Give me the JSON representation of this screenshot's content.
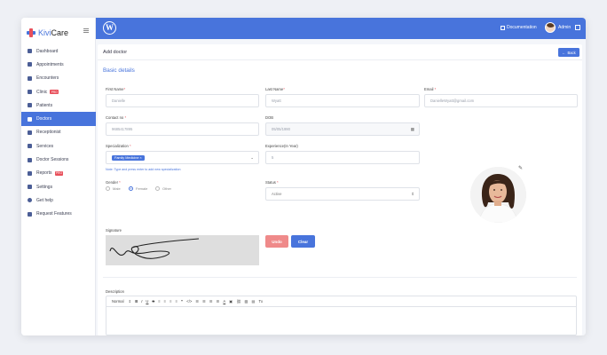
{
  "brand": {
    "name_part1": "Kivi",
    "name_part2": "Care"
  },
  "sidebar": {
    "items": [
      {
        "label": "Dashboard"
      },
      {
        "label": "Appointments"
      },
      {
        "label": "Encounters"
      },
      {
        "label": "Clinic",
        "badge": "PRO"
      },
      {
        "label": "Patients"
      },
      {
        "label": "Doctors",
        "active": true
      },
      {
        "label": "Receptionist"
      },
      {
        "label": "Services"
      },
      {
        "label": "Doctor Sessions"
      },
      {
        "label": "Reports",
        "badge": "PRO"
      },
      {
        "label": "Settings"
      },
      {
        "label": "Get help"
      },
      {
        "label": "Request Features"
      }
    ]
  },
  "topbar": {
    "wp_logo": "W",
    "documentation": "Documentation",
    "user": "Admin"
  },
  "page": {
    "title": "Add doctor",
    "back": "Back",
    "section": "Basic details"
  },
  "form": {
    "first_name": {
      "label": "First Name",
      "value": "Danielle"
    },
    "last_name": {
      "label": "Last Name",
      "value": "Wyatt"
    },
    "email": {
      "label": "Email",
      "value": "DanielleWyatt@gmail.com"
    },
    "contact": {
      "label": "Contact no",
      "value": "9685417895"
    },
    "dob": {
      "label": "DOB",
      "value": "05/05/1990"
    },
    "specialization": {
      "label": "Specialization",
      "tag": "Family Medicine",
      "hint": "Note: Type and press enter to add new specialization"
    },
    "experience": {
      "label": "Experience(In Year)",
      "value": "5"
    },
    "gender": {
      "label": "Gender",
      "options": [
        "Male",
        "Female",
        "Other"
      ],
      "selected": "Female"
    },
    "status": {
      "label": "Status",
      "value": "Active"
    },
    "signature": {
      "label": "Signature",
      "undo": "Undo",
      "clear": "Clear"
    },
    "description": {
      "label": "Description",
      "format": "Normal"
    }
  },
  "colors": {
    "primary": "#4874dc",
    "danger": "#e8505b",
    "undo": "#ef8a8a"
  }
}
